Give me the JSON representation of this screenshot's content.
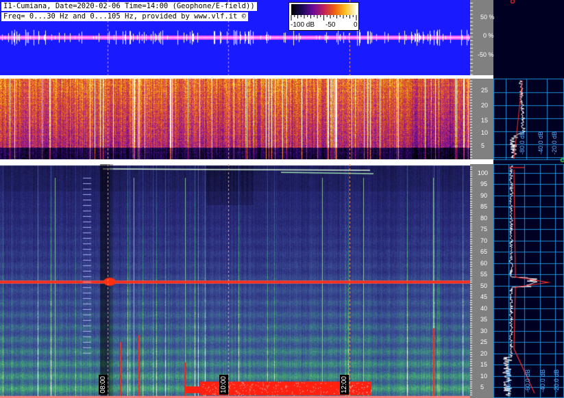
{
  "header": {
    "line1": "I1-Cumiana, Date=2020-02-06 Time=14:00 (Geophone/E-field))",
    "line2": "Freq= 0...30 Hz and 0...105 Hz, provided by www.vlf.it ©"
  },
  "colorbar": {
    "labels": [
      "-100 dB",
      "-50",
      "0"
    ]
  },
  "efield_axis": {
    "ticks": [
      "50 %",
      "0 %",
      "-50 %"
    ]
  },
  "low_freq_axis": {
    "ticks": [
      "25",
      "20",
      "15",
      "10",
      "5"
    ]
  },
  "high_freq_axis": {
    "ticks": [
      "100",
      "95",
      "90",
      "85",
      "80",
      "75",
      "70",
      "65",
      "60",
      "55",
      "50",
      "45",
      "40",
      "35",
      "30",
      "25",
      "20",
      "15",
      "10",
      "5"
    ]
  },
  "time_markers": [
    "08:00",
    "10:00",
    "12:00"
  ],
  "profile_axis": {
    "upper": [
      "-80.0 dB",
      "-40.0 dB",
      "-20.0 dB"
    ],
    "lower": [
      "-80.0 dB",
      "-60.0 dB",
      "-40.0 dB",
      "-20.0 dB"
    ]
  },
  "colors": {
    "efield_bg": "#1a1aff",
    "efield_line": "#ff66ff",
    "axis_bg": "#808080",
    "profile_bg": "#000033",
    "profile_grid": "#1f8fd8",
    "spectrum_line": "#ff2020"
  }
}
